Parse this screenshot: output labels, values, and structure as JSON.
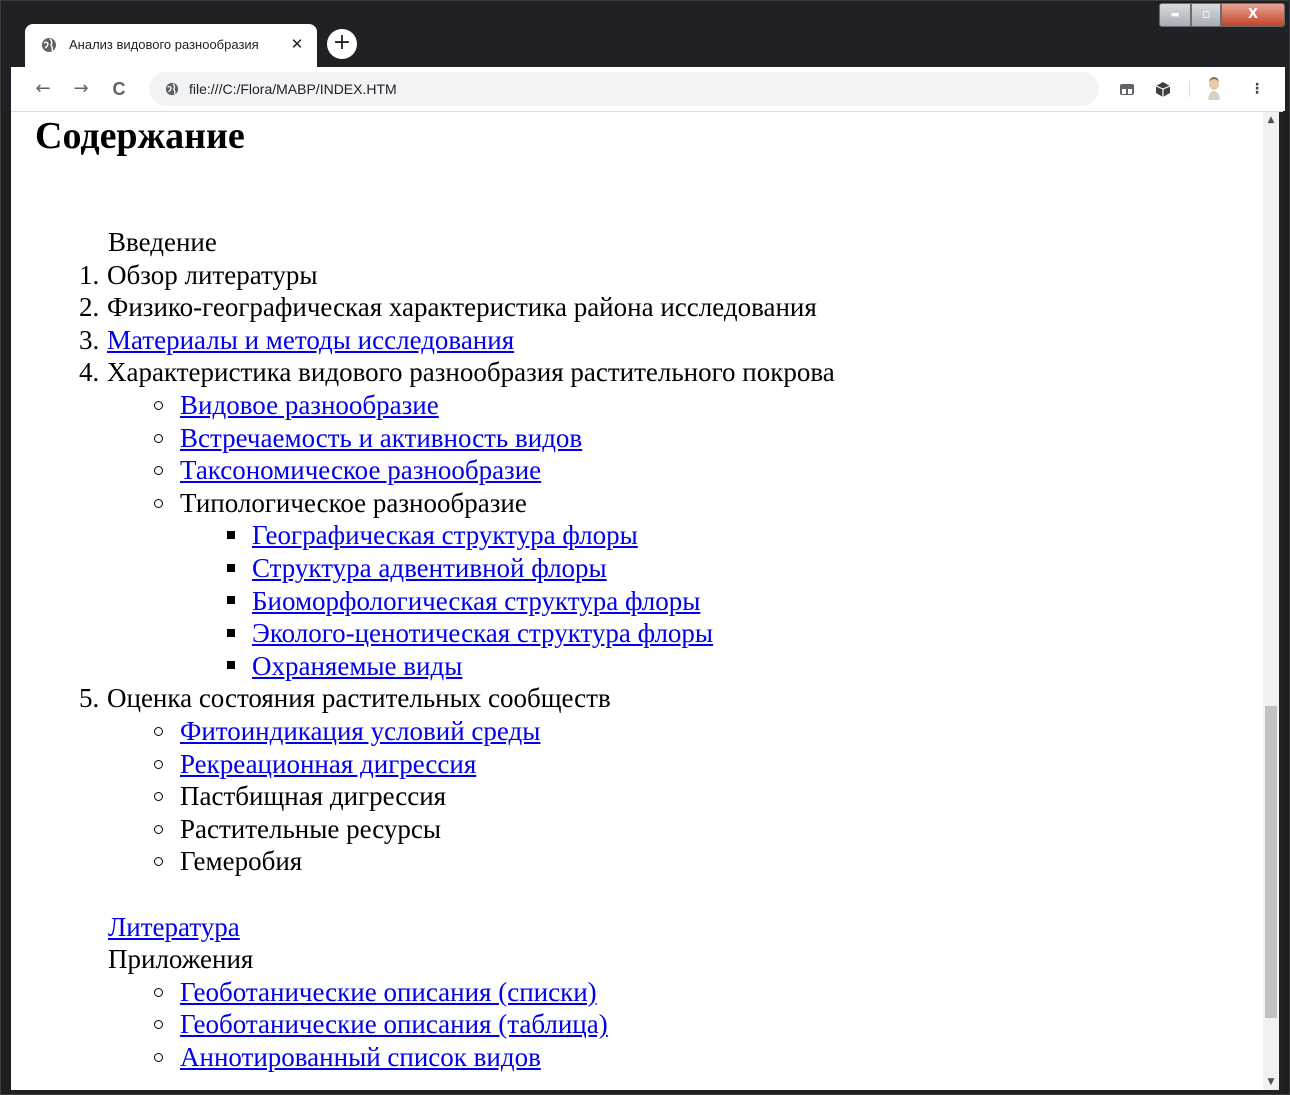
{
  "browser": {
    "tab_title": "Анализ видового разнообразия",
    "tab_close": "✕",
    "new_tab": "+",
    "url": "file:///C:/Flora/MABP/INDEX.HTM",
    "nav": {
      "back": "←",
      "forward": "→",
      "reload": "C"
    },
    "toolbar_icons": [
      "tab-search-icon",
      "extension-cube-icon",
      "profile-avatar-icon",
      "kebab-menu-icon"
    ],
    "window_controls": {
      "minimize": "▬",
      "maximize": "▫",
      "close": "X"
    }
  },
  "page": {
    "title": "Содержание",
    "toc": {
      "intro": "Введение",
      "items": [
        {
          "num": "1.",
          "label": "Обзор литературы"
        },
        {
          "num": "2.",
          "label": "Физико-географическая характеристика района исследования"
        },
        {
          "num": "3.",
          "label": "Материалы и методы исследования"
        },
        {
          "num": "4.",
          "label": "Характеристика видового разнообразия растительного покрова"
        },
        {
          "num": "5.",
          "label": "Оценка состояния растительных сообществ"
        }
      ],
      "section4": [
        "Видовое разнообразие",
        "Встречаемость и активность видов",
        "Таксономическое разнообразие",
        "Типологическое разнообразие"
      ],
      "typological": [
        "Географическая структура флоры",
        "Структура адвентивной флоры",
        "Биоморфологическая структура флоры",
        "Эколого-ценотическая структура флоры",
        "Охраняемые виды"
      ],
      "section5": [
        "Фитоиндикация условий среды",
        "Рекреационная дигрессия",
        "Пастбищная дигрессия",
        "Растительные ресурсы",
        "Гемеробия"
      ],
      "literature": "Литература",
      "appendices": "Приложения",
      "appendix_items": [
        "Геоботанические описания (списки)",
        "Геоботанические описания (таблица)",
        "Аннотированный список видов"
      ]
    }
  },
  "colors": {
    "link": "#0000ee",
    "text": "#000000",
    "chrome_dark": "#202124"
  }
}
